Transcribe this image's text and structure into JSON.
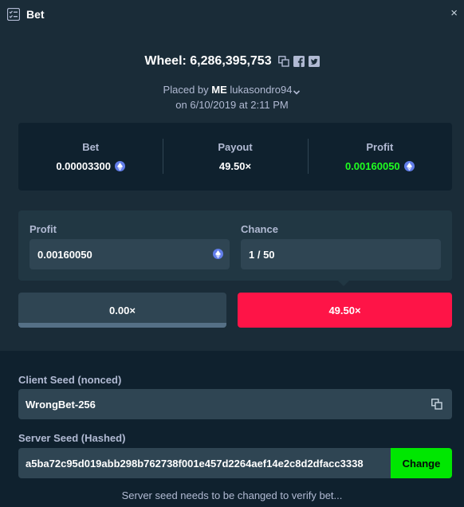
{
  "window": {
    "title": "Bet",
    "close_glyph": "×",
    "title_icon": "bet-list-icon"
  },
  "header": {
    "wheel_label": "Wheel: 6,286,395,753",
    "icons": [
      "copy-icon",
      "facebook-icon",
      "twitter-icon"
    ],
    "placed_prefix": "Placed by",
    "user_tag": "ME",
    "username": "lukasondro94",
    "date": "on 6/10/2019 at 2:11 PM"
  },
  "stats": {
    "bet_label": "Bet",
    "bet_value": "0.00003300",
    "payout_label": "Payout",
    "payout_value": "49.50×",
    "profit_label": "Profit",
    "profit_value": "0.00160050",
    "profit_color": "#1fff20",
    "currency_icon": "ethereum-icon"
  },
  "calculator": {
    "profit_label": "Profit",
    "profit_value": "0.00160050",
    "chance_label": "Chance",
    "chance_value": "1 / 50"
  },
  "segments": {
    "left_label": "0.00×",
    "right_label": "49.50×",
    "right_color": "#fe1447"
  },
  "seeds": {
    "client_label": "Client Seed (nonced)",
    "client_value": "WrongBet-256",
    "server_label": "Server Seed (Hashed)",
    "server_value": "a5ba72c95d019abb298b762738f001e457d2264aef14e2c8d2dfacc3338",
    "change_label": "Change",
    "change_color": "#00e701",
    "notice": "Server seed needs to be changed to verify bet..."
  }
}
